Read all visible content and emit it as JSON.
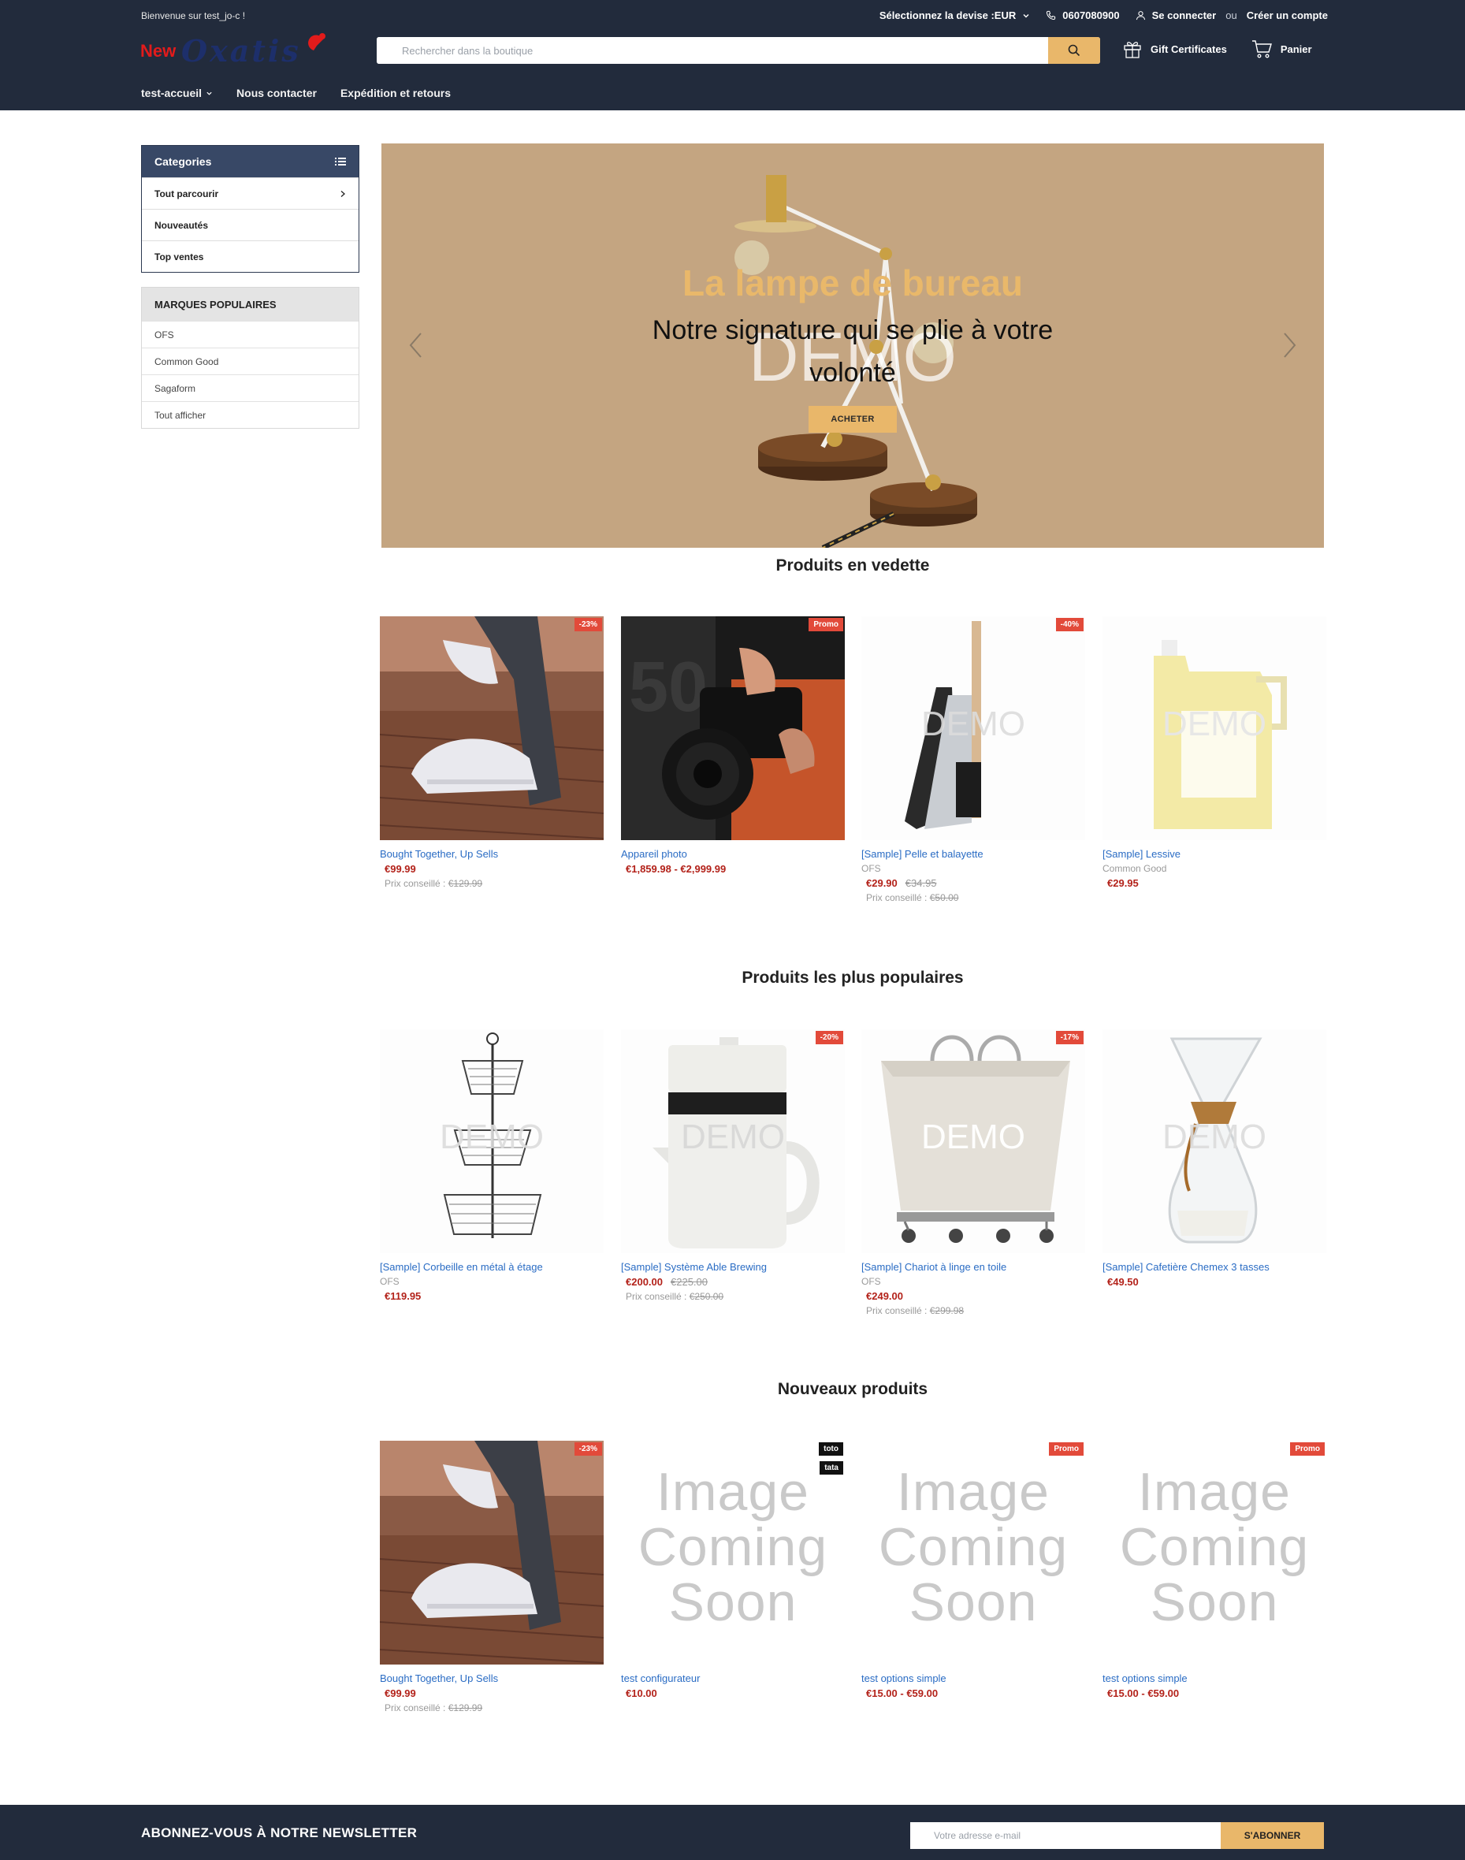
{
  "header": {
    "welcome": "Bienvenue sur test_jo-c !",
    "currency": "Sélectionnez la devise :EUR",
    "phone": "0607080900",
    "login": "Se connecter",
    "or": "ou",
    "register": "Créer un compte",
    "logo_text_a": "New",
    "logo_text_b": "Oxatis",
    "search_placeholder": "Rechercher dans la boutique",
    "gift": "Gift Certificates",
    "cart": "Panier",
    "nav": [
      "test-accueil",
      "Nous contacter",
      "Expédition et retours"
    ]
  },
  "sidebar": {
    "categories_title": "Categories",
    "categories": [
      "Tout parcourir",
      "Nouveautés",
      "Top ventes"
    ],
    "brands_title": "MARQUES POPULAIRES",
    "brands": [
      "OFS",
      "Common Good",
      "Sagaform",
      "Tout afficher"
    ]
  },
  "hero": {
    "title": "La lampe de bureau",
    "subtitle": "Notre signature qui se plie à votre volonté",
    "button": "ACHETER",
    "watermark": "DEMO"
  },
  "sections": [
    {
      "title": "Produits en vedette",
      "products": [
        {
          "name": "Bought Together, Up Sells",
          "brand": "",
          "price": "€99.99",
          "old_price": "",
          "retail_label": "Prix conseillé :",
          "retail": "€129.99",
          "badge": "-23%"
        },
        {
          "name": "Appareil photo",
          "brand": "",
          "price": "€1,859.98 - €2,999.99",
          "old_price": "",
          "retail_label": "",
          "retail": "",
          "badge": "Promo"
        },
        {
          "name": "[Sample] Pelle et balayette",
          "brand": "OFS",
          "price": "€29.90",
          "old_price": "€34.95",
          "retail_label": "Prix conseillé :",
          "retail": "€50.00",
          "badge": "-40%"
        },
        {
          "name": "[Sample] Lessive",
          "brand": "Common Good",
          "price": "€29.95",
          "old_price": "",
          "retail_label": "",
          "retail": "",
          "badge": ""
        }
      ]
    },
    {
      "title": "Produits les plus populaires",
      "products": [
        {
          "name": "[Sample] Corbeille en métal à étage",
          "brand": "OFS",
          "price": "€119.95",
          "old_price": "",
          "retail_label": "",
          "retail": "",
          "badge": ""
        },
        {
          "name": "[Sample] Système Able Brewing",
          "brand": "",
          "price": "€200.00",
          "old_price": "€225.00",
          "retail_label": "Prix conseillé :",
          "retail": "€250.00",
          "badge": "-20%"
        },
        {
          "name": "[Sample] Chariot à linge en toile",
          "brand": "OFS",
          "price": "€249.00",
          "old_price": "",
          "retail_label": "Prix conseillé :",
          "retail": "€299.98",
          "badge": "-17%"
        },
        {
          "name": "[Sample] Cafetière Chemex 3 tasses",
          "brand": "",
          "price": "€49.50",
          "old_price": "",
          "retail_label": "",
          "retail": "",
          "badge": ""
        }
      ]
    },
    {
      "title": "Nouveaux produits",
      "products": [
        {
          "name": "Bought Together, Up Sells",
          "brand": "",
          "price": "€99.99",
          "old_price": "",
          "retail_label": "Prix conseillé :",
          "retail": "€129.99",
          "badge": "-23%"
        },
        {
          "name": "test configurateur",
          "brand": "",
          "price": "€10.00",
          "old_price": "",
          "retail_label": "",
          "retail": "",
          "badge": "toto",
          "badge2": "tata"
        },
        {
          "name": "test options simple",
          "brand": "",
          "price": "€15.00 - €59.00",
          "old_price": "",
          "retail_label": "",
          "retail": "",
          "badge": "Promo"
        },
        {
          "name": "test options simple",
          "brand": "",
          "price": "€15.00 - €59.00",
          "old_price": "",
          "retail_label": "",
          "retail": "",
          "badge": "Promo"
        }
      ]
    }
  ],
  "placeholder_image": [
    "Image",
    "Coming",
    "Soon"
  ],
  "demo": "DEMO",
  "newsletter": {
    "title": "ABONNEZ-VOUS À NOTRE NEWSLETTER",
    "placeholder": "Votre adresse e-mail",
    "button": "S'ABONNER"
  },
  "colors": {
    "header_bg": "#222b3c",
    "accent": "#e9b76a",
    "badge_red": "#e24a3a",
    "price_red": "#b3221a",
    "link_blue": "#2a6cc4"
  }
}
